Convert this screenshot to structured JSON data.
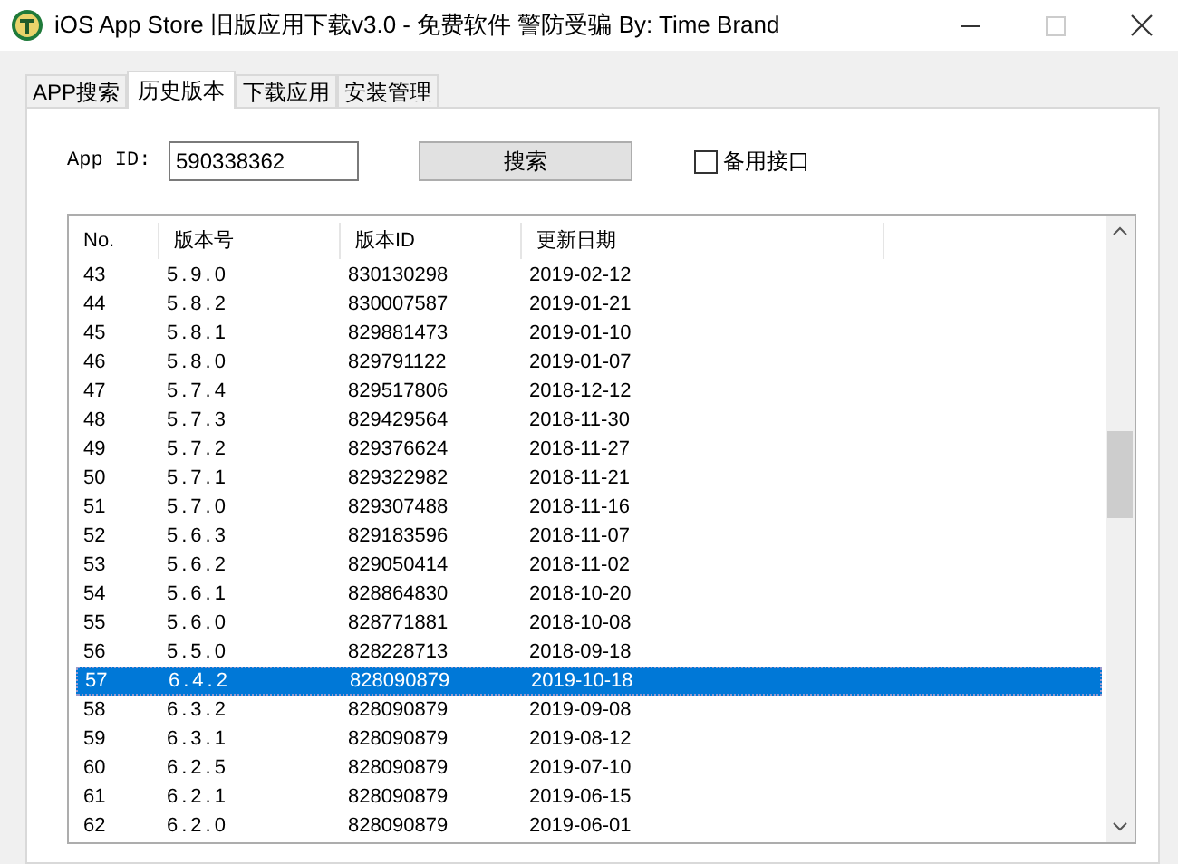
{
  "window": {
    "title": "iOS App Store 旧版应用下载v3.0 - 免费软件 警防受骗 By: Time Brand"
  },
  "tabs": [
    {
      "label": "APP搜索",
      "selected": false
    },
    {
      "label": "历史版本",
      "selected": true
    },
    {
      "label": "下载应用",
      "selected": false
    },
    {
      "label": "安装管理",
      "selected": false
    }
  ],
  "app_id": {
    "label": "App ID:",
    "value": "590338362"
  },
  "search_button": "搜索",
  "backup_api": {
    "label": "备用接口",
    "checked": false
  },
  "table": {
    "columns": [
      "No.",
      "版本号",
      "版本ID",
      "更新日期"
    ],
    "rows": [
      {
        "cells": [
          "43",
          "5.9.0",
          "830130298",
          "2019-02-12"
        ],
        "selected": false
      },
      {
        "cells": [
          "44",
          "5.8.2",
          "830007587",
          "2019-01-21"
        ],
        "selected": false
      },
      {
        "cells": [
          "45",
          "5.8.1",
          "829881473",
          "2019-01-10"
        ],
        "selected": false
      },
      {
        "cells": [
          "46",
          "5.8.0",
          "829791122",
          "2019-01-07"
        ],
        "selected": false
      },
      {
        "cells": [
          "47",
          "5.7.4",
          "829517806",
          "2018-12-12"
        ],
        "selected": false
      },
      {
        "cells": [
          "48",
          "5.7.3",
          "829429564",
          "2018-11-30"
        ],
        "selected": false
      },
      {
        "cells": [
          "49",
          "5.7.2",
          "829376624",
          "2018-11-27"
        ],
        "selected": false
      },
      {
        "cells": [
          "50",
          "5.7.1",
          "829322982",
          "2018-11-21"
        ],
        "selected": false
      },
      {
        "cells": [
          "51",
          "5.7.0",
          "829307488",
          "2018-11-16"
        ],
        "selected": false
      },
      {
        "cells": [
          "52",
          "5.6.3",
          "829183596",
          "2018-11-07"
        ],
        "selected": false
      },
      {
        "cells": [
          "53",
          "5.6.2",
          "829050414",
          "2018-11-02"
        ],
        "selected": false
      },
      {
        "cells": [
          "54",
          "5.6.1",
          "828864830",
          "2018-10-20"
        ],
        "selected": false
      },
      {
        "cells": [
          "55",
          "5.6.0",
          "828771881",
          "2018-10-08"
        ],
        "selected": false
      },
      {
        "cells": [
          "56",
          "5.5.0",
          "828228713",
          "2018-09-18"
        ],
        "selected": false
      },
      {
        "cells": [
          "57",
          "6.4.2",
          "828090879",
          "2019-10-18"
        ],
        "selected": true
      },
      {
        "cells": [
          "58",
          "6.3.2",
          "828090879",
          "2019-09-08"
        ],
        "selected": false
      },
      {
        "cells": [
          "59",
          "6.3.1",
          "828090879",
          "2019-08-12"
        ],
        "selected": false
      },
      {
        "cells": [
          "60",
          "6.2.5",
          "828090879",
          "2019-07-10"
        ],
        "selected": false
      },
      {
        "cells": [
          "61",
          "6.2.1",
          "828090879",
          "2019-06-15"
        ],
        "selected": false
      },
      {
        "cells": [
          "62",
          "6.2.0",
          "828090879",
          "2019-06-01"
        ],
        "selected": false
      }
    ]
  }
}
